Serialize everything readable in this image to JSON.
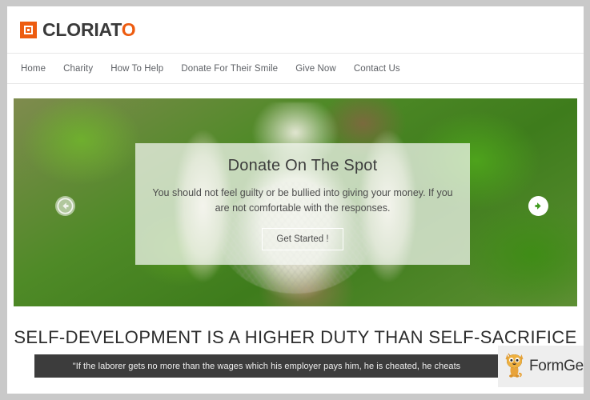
{
  "site": {
    "logo_text_main": "CLORIAT",
    "logo_text_accent": "O",
    "logo_icon": "square-target-icon",
    "accent_color": "#ed5c10"
  },
  "nav": {
    "items": [
      {
        "label": "Home"
      },
      {
        "label": "Charity"
      },
      {
        "label": "How To Help"
      },
      {
        "label": "Donate For Their Smile"
      },
      {
        "label": "Give Now"
      },
      {
        "label": "Contact Us"
      }
    ]
  },
  "hero": {
    "title": "Donate On The Spot",
    "description": "You should not feel guilty or be bullied into giving your money. If you are not comfortable with the responses.",
    "button_label": "Get Started !",
    "prev_icon": "arrow-left-circle-icon",
    "next_icon": "arrow-right-circle-icon"
  },
  "headline": {
    "text": "SELF-DEVELOPMENT IS A HIGHER DUTY THAN SELF-SACRIFICE"
  },
  "quote": {
    "text": "\"If the laborer gets no more than the wages which his employer pays him, he is cheated, he cheats",
    "background_color": "#3c3c3c"
  },
  "watermark": {
    "brand": "FormGet",
    "mascot_icon": "cat-mascot-icon"
  }
}
